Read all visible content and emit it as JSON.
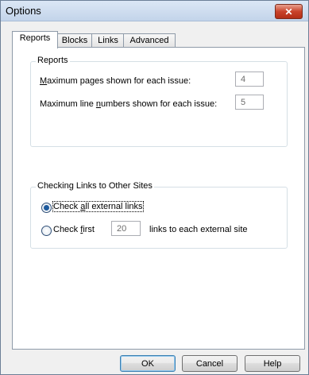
{
  "window": {
    "title": "Options",
    "close_symbol": "✕"
  },
  "tabs": [
    {
      "label": "Reports",
      "active": true
    },
    {
      "label": "Blocks",
      "active": false
    },
    {
      "label": "Links",
      "active": false
    },
    {
      "label": "Advanced",
      "active": false
    }
  ],
  "reports": {
    "legend": "Reports",
    "max_pages_label": "Maximum pages shown for each issue:",
    "max_pages_value": "4",
    "max_line_numbers_label": "Maximum line numbers shown for each issue:",
    "max_line_numbers_value": "5"
  },
  "checking_links": {
    "legend": "Checking Links to Other Sites",
    "option_all_label": "Check all external links",
    "option_first_label": "Check first",
    "first_count_value": "20",
    "suffix_label": "links to each external site",
    "selected": "all"
  },
  "buttons": {
    "ok": "OK",
    "cancel": "Cancel",
    "help": "Help"
  }
}
